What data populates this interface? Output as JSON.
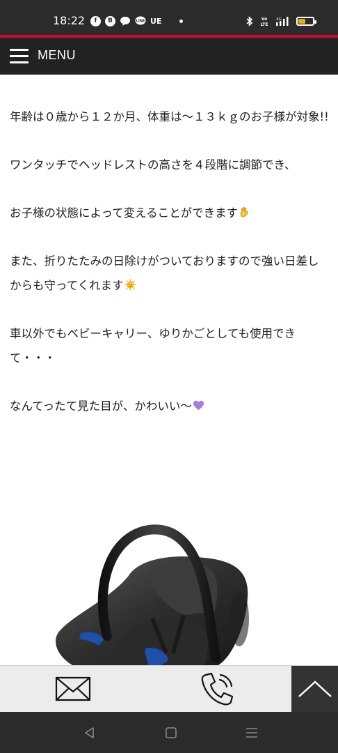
{
  "status_bar": {
    "time": "18:22",
    "app_icons": [
      "facebook-icon",
      "bubble-b-icon",
      "chat-icon",
      "line-icon"
    ],
    "carrier_text": "UE",
    "right_icons": [
      "bluetooth-icon",
      "volte-icon",
      "4g-signal-icon",
      "battery-icon"
    ],
    "vo_lte": "Vo LTE",
    "net": "4G",
    "battery_level": 0.45,
    "battery_color": "#e0b01a"
  },
  "header": {
    "menu_label": "MENU",
    "background": "#222222",
    "accent": "#c8102e"
  },
  "article": {
    "paragraphs": [
      "年齢は０歳から１２か月、体重は～１３ｋｇのお子様が対象!!",
      "ワンタッチでヘッドレストの高さを４段階に調節でき、",
      "お子様の状態によって変えることができます",
      "また、折りたたみの日除けがついておりますので強い日差しからも守ってくれます",
      "車以外でもベビーキャリー、ゆりかごとしても使用できて・・・",
      "なんてったて見た目が、かわいい～"
    ],
    "emojis": {
      "p3": "ok-hand-emoji-icon",
      "p4": "sun-face-emoji-icon",
      "p6": "purple-heart-emoji-icon"
    },
    "image": "baby-car-seat-photo"
  },
  "action_bar": {
    "mail_icon": "envelope-icon",
    "phone_icon": "phone-icon",
    "top_icon": "chevron-up-icon"
  },
  "nav_bar": {
    "buttons": [
      "back-triangle-icon",
      "home-square-icon",
      "recents-menu-icon"
    ]
  }
}
